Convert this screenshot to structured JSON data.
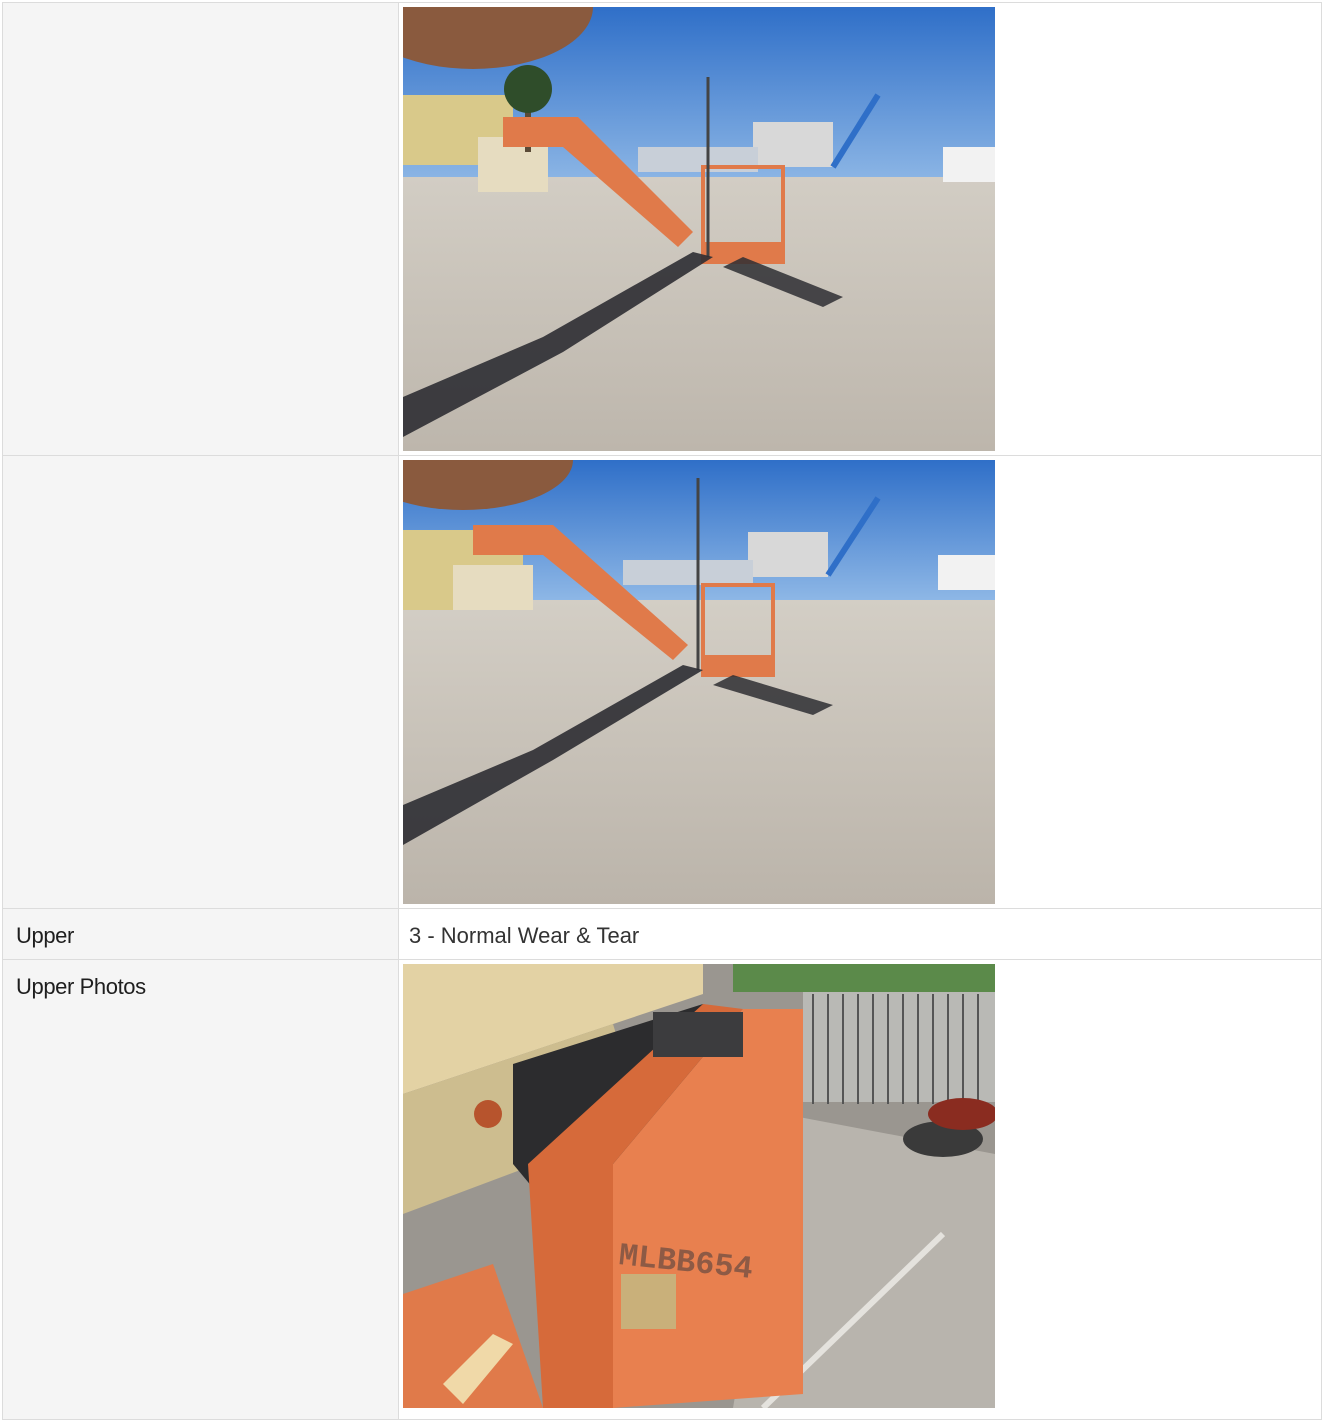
{
  "rows": [
    {
      "label": "",
      "type": "photo",
      "photo": "aerial-lift-boom-yard-photo-1"
    },
    {
      "label": "",
      "type": "photo",
      "photo": "aerial-lift-boom-yard-photo-2"
    },
    {
      "label": "Upper",
      "type": "text",
      "value": "3 - Normal Wear & Tear"
    },
    {
      "label": "Upper Photos",
      "type": "photo",
      "photo": "upper-orange-cover-photo",
      "stencil": "MLBB654"
    }
  ],
  "colors": {
    "sky": "#3f7fd0",
    "concrete": "#c9c3ba",
    "boom_orange": "#e07a4a",
    "cover_orange": "#e8804f"
  }
}
